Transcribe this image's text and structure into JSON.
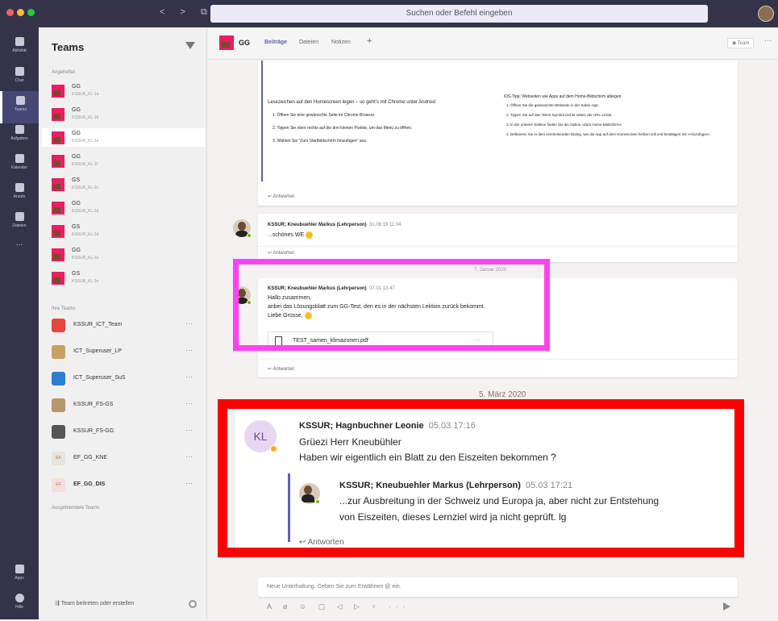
{
  "window": {
    "search_placeholder": "Suchen oder Befehl eingeben",
    "nav_arrows": "< > ⧉"
  },
  "rail": [
    {
      "label": "Aktivität",
      "icon": "bell-icon"
    },
    {
      "label": "Chat",
      "icon": "chat-icon"
    },
    {
      "label": "Teams",
      "icon": "teams-icon"
    },
    {
      "label": "Aufgaben",
      "icon": "assignments-icon"
    },
    {
      "label": "Kalender",
      "icon": "calendar-icon"
    },
    {
      "label": "Anrufe",
      "icon": "phone-icon"
    },
    {
      "label": "Dateien",
      "icon": "files-icon"
    },
    {
      "label": "...",
      "icon": "more-icon"
    },
    {
      "label": "Apps",
      "icon": "apps-icon"
    },
    {
      "label": "Hilfe",
      "icon": "help-icon"
    }
  ],
  "teams_pane": {
    "title": "Teams",
    "pinned_label": "Angeheftet",
    "pinned": [
      {
        "name": "GG",
        "sub": "KSSUR_KL-1a"
      },
      {
        "name": "GG",
        "sub": "KSSUR_KL-1b"
      },
      {
        "name": "GG",
        "sub": "KSSUR_KL-1e"
      },
      {
        "name": "GG",
        "sub": "KSSUR_KL-1f"
      },
      {
        "name": "GS",
        "sub": "KSSUR_KL-2c"
      },
      {
        "name": "GG",
        "sub": "KSSUR_KL-2d"
      },
      {
        "name": "GS",
        "sub": "KSSUR_KL-2d"
      },
      {
        "name": "GG",
        "sub": "KSSUR_KL-2e"
      },
      {
        "name": "GS",
        "sub": "KSSUR_KL-2e"
      }
    ],
    "my_teams_label": "Ihre Teams",
    "my_teams": [
      {
        "name": "KSSUR_ICT_Team",
        "color": "#e8453c"
      },
      {
        "name": "ICT_Superuser_LP",
        "color": "#c8a060"
      },
      {
        "name": "ICT_Superuser_SuS",
        "color": "#2d7dd2"
      },
      {
        "name": "KSSUR_FS-GS",
        "color": "#b8956a"
      },
      {
        "name": "KSSUR_FS-GG",
        "color": "#555555"
      },
      {
        "name": "EF_GG_KNE",
        "color": "#e8e3dc",
        "abbr": "EF"
      },
      {
        "name": "EF_GG_DIS",
        "color": "#f5dede",
        "abbr": "EF"
      }
    ],
    "hidden_label": "Ausgeblendete Teams",
    "join_label": "Team beitreten oder erstellen"
  },
  "header": {
    "title": "GG",
    "tabs": [
      "Beiträge",
      "Dateien",
      "Notizen",
      "+"
    ],
    "team_button": "Team",
    "more": "···"
  },
  "posts": {
    "tips": {
      "left_title": "Lesezeichen auf den Homescreen legen – so geht's mit Chrome unter Android",
      "left_steps": [
        "1.  Öffnen Sie eine gewünschte Seite im Chrome Browser.",
        "2.  Tippen Sie oben rechts auf die drei kleinen Punkte, um das Menü zu öffnen.",
        "3.  Wählen Sie \"Zum Startbildschirm hinzufügen\" aus."
      ],
      "right_title": "iOS-Tipp: Webseiten wie Apps auf dem Home-Bildschirm ablegen",
      "right_steps": [
        "1.  Öffnen Sie die gewünschte Webseite in der Safari-App.",
        "2.  Tippen Sie auf das Teilen-Symbol rechts neben der URL-Leiste.",
        "3.  In der unteren Sektion finden Sie die Option »Zum Home-Bildschirm«.",
        "4.  Definieren Sie in dem erscheinenden Dialog, wie die App auf dem Homescreen heißen soll und bestätigen mit »Hinzufügen«."
      ],
      "reply": "Antworten"
    },
    "post1": {
      "author": "KSSUR; Kneubuehler Markus (Lehrperson)",
      "time": "31.08.19 11:04",
      "text": "...schönes WE",
      "reply": "Antworten"
    },
    "date_divider_1": "7. Januar 2020",
    "post2": {
      "author": "KSSUR; Kneubuehler Markus (Lehrperson)",
      "time": "07.01 13:47",
      "lines": [
        "Hallo zusammen,",
        "anbei das Lösungsblatt zum GG-Test, den es in der nächsten Lektion zurück bekommt.",
        "Liebe Grüsse,"
      ],
      "attachment": "TEST_samen_klimazonen.pdf",
      "attachment_more": "···",
      "reply": "Antworten"
    },
    "date_divider_2": "5. März 2020",
    "post3": {
      "initials": "KL",
      "author": "KSSUR; Hagnbuchner Leonie",
      "time": "05.03 17:16",
      "lines": [
        "Grüezi Herr Kneubühler",
        "Haben wir eigentlich ein Blatt zu den Eiszeiten bekommen ?"
      ],
      "reply_author": "KSSUR; Kneubuehler Markus (Lehrperson)",
      "reply_time": "05.03 17:21",
      "reply_lines": [
        "...zur Ausbreitung in der Schweiz und Europa ja, aber nicht zur Entstehung",
        "von Eiszeiten, dieses Lernziel wird ja nicht geprüft. lg"
      ],
      "reply": "Antworten"
    }
  },
  "composer": {
    "placeholder": "Neue Unterhaltung. Geben Sie zum Erwähnen @ ein.",
    "tools": "A ⌀ ☺ ▢ ◁ ▷ ♀ ···"
  },
  "highlights": {
    "magenta": "#ff44ee",
    "red": "#ff0000"
  }
}
